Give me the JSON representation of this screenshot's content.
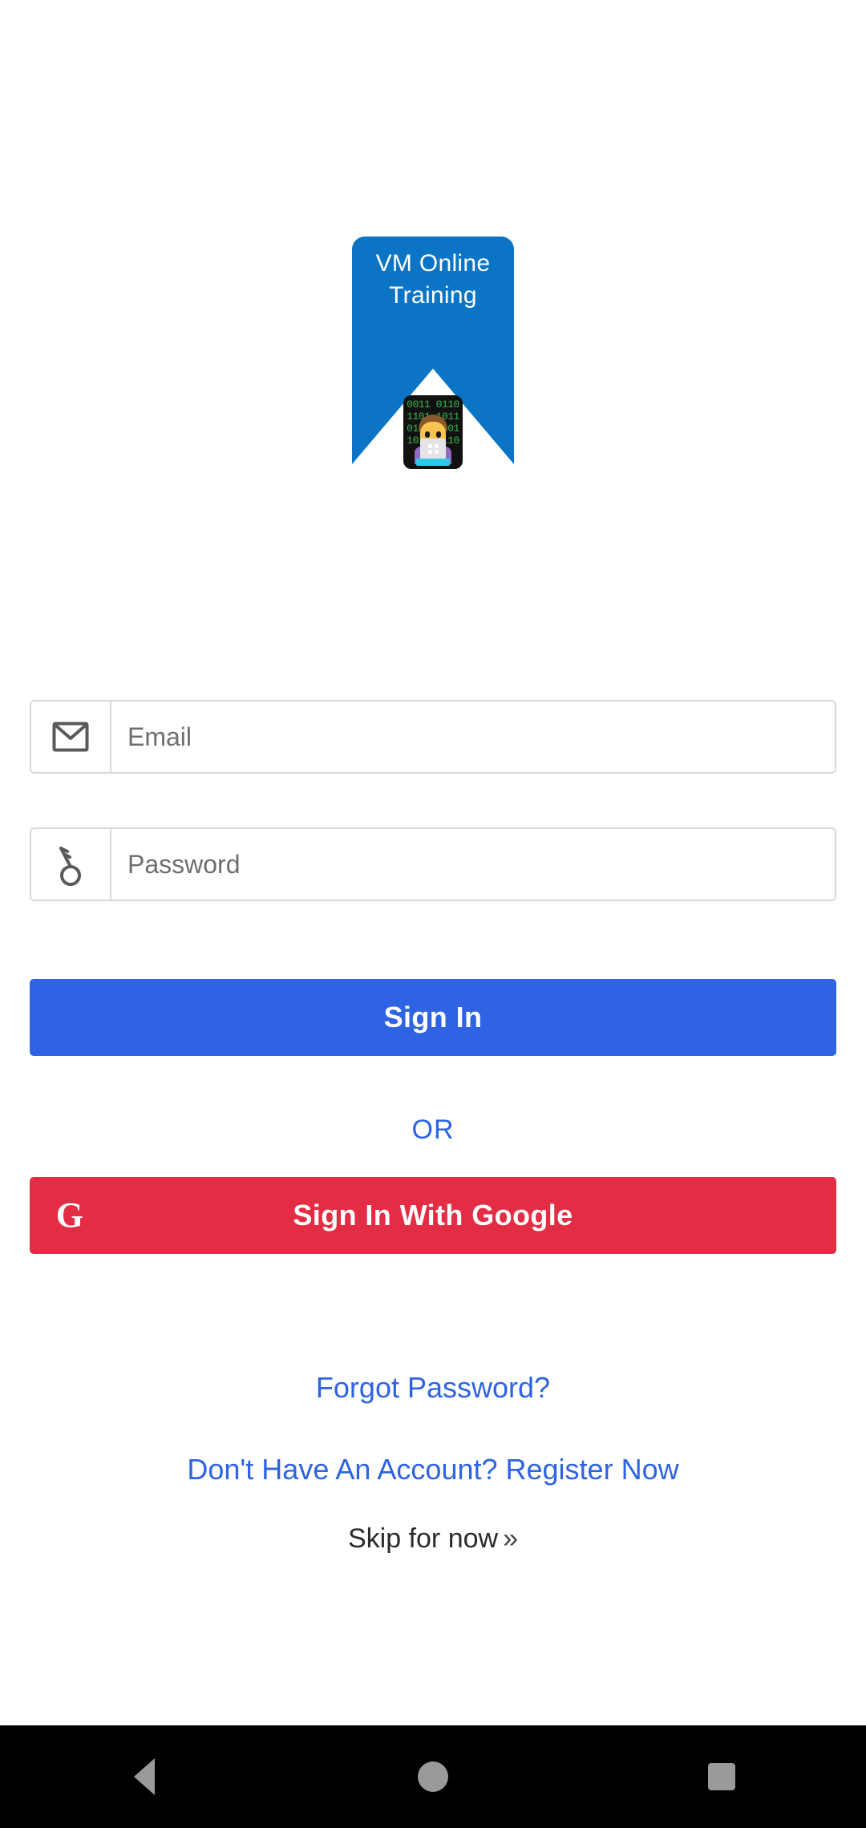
{
  "app": {
    "brand_blue": "#0B74C4",
    "primary_blue": "#2E63E4",
    "google_red": "#E32D45",
    "background": "#ffffff"
  },
  "logo": {
    "text": "VM Online\nTraining",
    "icon_name": "technologist-avatar-icon",
    "binary_pattern": "0011 0110\n1101 1011\n0101 1001\n1011 0110"
  },
  "form": {
    "email": {
      "icon": "envelope-icon",
      "placeholder": "Email",
      "value": ""
    },
    "password": {
      "icon": "key-icon",
      "placeholder": "Password",
      "value": ""
    }
  },
  "actions": {
    "sign_in_label": "Sign In",
    "or_label": "OR",
    "google_icon_glyph": "G",
    "google_sign_in_label": "Sign In With Google"
  },
  "links": {
    "forgot_password": "Forgot Password?",
    "register": "Don't Have An Account? Register Now",
    "skip": "Skip for now",
    "skip_chevron": "»"
  },
  "navbar": {
    "back": "back-button",
    "home": "home-button",
    "recents": "recents-button"
  }
}
